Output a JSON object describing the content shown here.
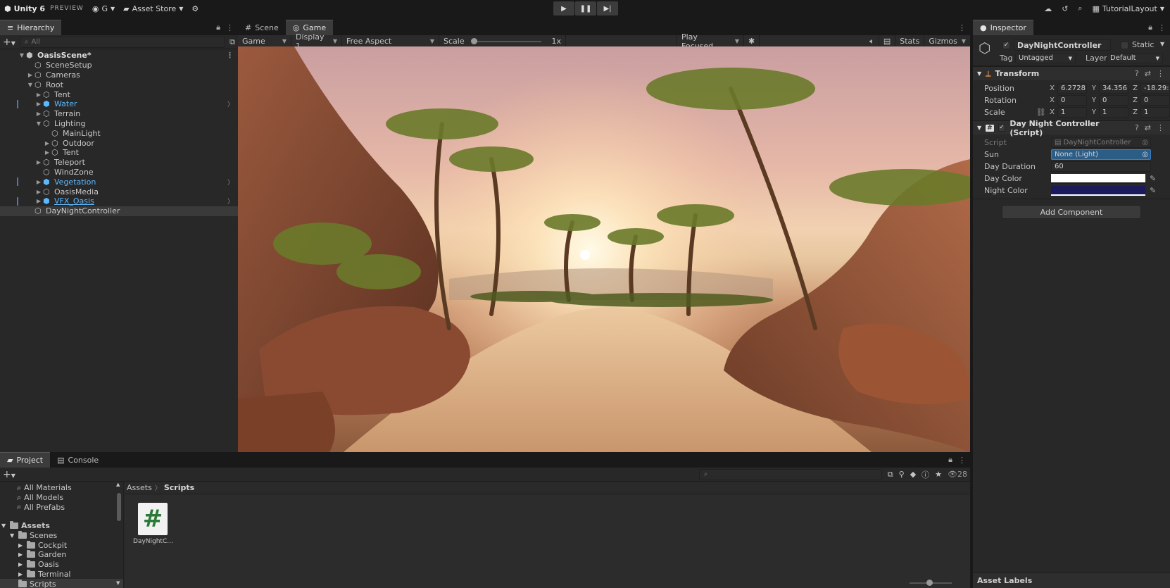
{
  "toolbar": {
    "app_name": "Unity 6",
    "edition": "PREVIEW",
    "account": "G",
    "asset_store": "Asset Store",
    "layout": "TutorialLayout"
  },
  "hierarchy": {
    "tab": "Hierarchy",
    "search_placeholder": "All",
    "scene": "OasisScene*",
    "rows": [
      {
        "label": "SceneSetup"
      },
      {
        "label": "Cameras"
      },
      {
        "label": "Root"
      },
      {
        "label": "Tent"
      },
      {
        "label": "Water"
      },
      {
        "label": "Terrain"
      },
      {
        "label": "Lighting"
      },
      {
        "label": "MainLight"
      },
      {
        "label": "Outdoor"
      },
      {
        "label": "Tent"
      },
      {
        "label": "Teleport"
      },
      {
        "label": "WindZone"
      },
      {
        "label": "Vegetation"
      },
      {
        "label": "OasisMedia"
      },
      {
        "label": "VFX_Oasis"
      },
      {
        "label": "DayNightController"
      }
    ]
  },
  "game_view": {
    "tabs": [
      "Scene",
      "Game"
    ],
    "mode": "Game",
    "display": "Display 1",
    "aspect": "Free Aspect",
    "scale_label": "Scale",
    "scale_value": "1x",
    "play_focus": "Play Focused",
    "stats": "Stats",
    "gizmos": "Gizmos"
  },
  "inspector": {
    "tab": "Inspector",
    "object_name": "DayNightController",
    "static_label": "Static",
    "tag_label": "Tag",
    "tag_value": "Untagged",
    "layer_label": "Layer",
    "layer_value": "Default",
    "transform": {
      "title": "Transform",
      "position_label": "Position",
      "rotation_label": "Rotation",
      "scale_label": "Scale",
      "position": [
        "6.2728",
        "34.356",
        "-18.29:"
      ],
      "rotation": [
        "0",
        "0",
        "0"
      ],
      "scale": [
        "1",
        "1",
        "1"
      ]
    },
    "script_component": {
      "title": "Day Night Controller (Script)",
      "script_label": "Script",
      "script_value": "DayNightController",
      "sun_label": "Sun",
      "sun_value": "None (Light)",
      "duration_label": "Day Duration",
      "duration_value": "60",
      "day_color_label": "Day Color",
      "night_color_label": "Night Color",
      "day_color": "#ffffff",
      "night_color": "#1a1a5c"
    },
    "add_component": "Add Component",
    "asset_labels": "Asset Labels"
  },
  "project": {
    "tabs": [
      "Project",
      "Console"
    ],
    "asset_count": "28",
    "favorites": [
      "All Materials",
      "All Models",
      "All Prefabs"
    ],
    "tree": [
      {
        "label": "Assets",
        "bold": true
      },
      {
        "label": "Scenes"
      },
      {
        "label": "Cockpit"
      },
      {
        "label": "Garden"
      },
      {
        "label": "Oasis"
      },
      {
        "label": "Terminal"
      },
      {
        "label": "Scripts"
      }
    ],
    "breadcrumb_root": "Assets",
    "breadcrumb_current": "Scripts",
    "file_label": "DayNightC...",
    "file_glyph": "#"
  },
  "colors": {
    "accent_blue": "#3d7dc4",
    "prefab_blue": "#5cb9ff",
    "panel_bg": "#282828",
    "toolbar_bg": "#191919"
  }
}
